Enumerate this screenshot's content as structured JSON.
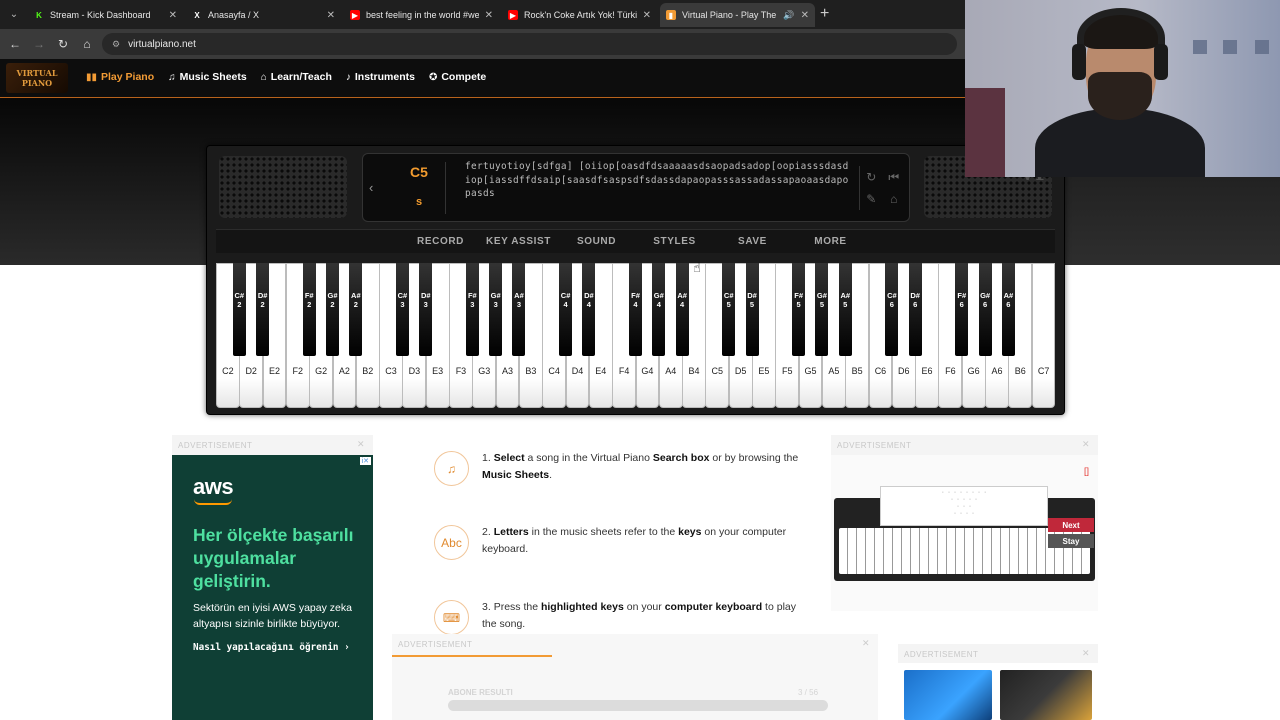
{
  "browser": {
    "tabs": [
      {
        "title": "Stream - Kick Dashboard",
        "fav_color": "#1f1f1f",
        "fav_glyph": "K",
        "fav_text": "#53fc18",
        "active": false
      },
      {
        "title": "Anasayfa / X",
        "fav_color": "#1f1f1f",
        "fav_glyph": "X",
        "fav_text": "#ffffff",
        "active": false
      },
      {
        "title": "best feeling in the world #wee",
        "fav_color": "#ff0000",
        "fav_glyph": "▶",
        "fav_text": "#ffffff",
        "active": false
      },
      {
        "title": "Rock'n Coke Artık Yok! Türkiye'",
        "fav_color": "#ff0000",
        "fav_glyph": "▶",
        "fav_text": "#ffffff",
        "active": false
      },
      {
        "title": "Virtual Piano - Play The Be",
        "fav_color": "#f29b35",
        "fav_glyph": "▮",
        "fav_text": "#ffffff",
        "active": true
      }
    ],
    "url": "virtualpiano.net"
  },
  "site": {
    "logo_line1": "VIRTUAL",
    "logo_line2": "PIANO",
    "nav": [
      {
        "label": "Play Piano",
        "icon": "piano-keys-icon",
        "glyph": "▮▮",
        "active": true
      },
      {
        "label": "Music Sheets",
        "icon": "music-notes-icon",
        "glyph": "♫",
        "active": false
      },
      {
        "label": "Learn/Teach",
        "icon": "graduation-cap-icon",
        "glyph": "⌂",
        "active": false
      },
      {
        "label": "Instruments",
        "icon": "guitar-icon",
        "glyph": "♪",
        "active": false
      },
      {
        "label": "Compete",
        "icon": "trophy-icon",
        "glyph": "✪",
        "active": false
      }
    ]
  },
  "piano": {
    "current_note": "C5",
    "current_key": "s",
    "sheet_text": "fertuyotioy[sdfga] [oiiop[oasdfdsaaaaasdsaopadsadop[oopiasssdasdiop[iassdffdsaip[saasdfsaspsdfsdassdapaopasssassadassapaoaasdapopasds",
    "menu": [
      "RECORD",
      "KEY ASSIST",
      "SOUND",
      "STYLES",
      "SAVE",
      "MORE"
    ],
    "white_keys": [
      "C2",
      "D2",
      "E2",
      "F2",
      "G2",
      "A2",
      "B2",
      "C3",
      "D3",
      "E3",
      "F3",
      "G3",
      "A3",
      "B3",
      "C4",
      "D4",
      "E4",
      "F4",
      "G4",
      "A4",
      "B4",
      "C5",
      "D5",
      "E5",
      "F5",
      "G5",
      "A5",
      "B5",
      "C6",
      "D6",
      "E6",
      "F6",
      "G6",
      "A6",
      "B6",
      "C7"
    ],
    "black_keys": [
      {
        "name": "C#",
        "oct": "2"
      },
      {
        "name": "D#",
        "oct": "2"
      },
      {
        "name": "F#",
        "oct": "2"
      },
      {
        "name": "G#",
        "oct": "2"
      },
      {
        "name": "A#",
        "oct": "2"
      },
      {
        "name": "C#",
        "oct": "3"
      },
      {
        "name": "D#",
        "oct": "3"
      },
      {
        "name": "F#",
        "oct": "3"
      },
      {
        "name": "G#",
        "oct": "3"
      },
      {
        "name": "A#",
        "oct": "3"
      },
      {
        "name": "C#",
        "oct": "4"
      },
      {
        "name": "D#",
        "oct": "4"
      },
      {
        "name": "F#",
        "oct": "4"
      },
      {
        "name": "G#",
        "oct": "4"
      },
      {
        "name": "A#",
        "oct": "4"
      },
      {
        "name": "C#",
        "oct": "5"
      },
      {
        "name": "D#",
        "oct": "5"
      },
      {
        "name": "F#",
        "oct": "5"
      },
      {
        "name": "G#",
        "oct": "5"
      },
      {
        "name": "A#",
        "oct": "5"
      },
      {
        "name": "C#",
        "oct": "6"
      },
      {
        "name": "D#",
        "oct": "6"
      },
      {
        "name": "F#",
        "oct": "6"
      },
      {
        "name": "G#",
        "oct": "6"
      },
      {
        "name": "A#",
        "oct": "6"
      }
    ]
  },
  "ads": {
    "label": "ADVERTISEMENT",
    "aws": {
      "brand": "aws",
      "headline": "Her ölçekte başarılı uygulamalar geliştirin.",
      "body": "Sektörün en iyisi AWS yapay zeka altyapısı sizinle birlikte büyüyor.",
      "cta": "Nasıl yapılacağını öğrenin ›"
    },
    "mid": {
      "progress_label": "ABONE RESULTI",
      "progress_count": "3 / 56",
      "progress_fraction": 1.0
    },
    "right": {
      "next_label": "Next",
      "stay_label": "Stay"
    }
  },
  "instructions": [
    {
      "icon": "music-note-icon",
      "glyph": "♫",
      "num": "1.",
      "parts": [
        [
          "b",
          "Select"
        ],
        [
          "t",
          " a song in the Virtual Piano "
        ],
        [
          "b",
          "Search box"
        ],
        [
          "t",
          " or by browsing the "
        ],
        [
          "b",
          "Music Sheets"
        ],
        [
          "t",
          "."
        ]
      ]
    },
    {
      "icon": "abc-letters-icon",
      "glyph": "Abc",
      "num": "2.",
      "parts": [
        [
          "b",
          "Letters"
        ],
        [
          "t",
          " in the music sheets refer to the "
        ],
        [
          "b",
          "keys"
        ],
        [
          "t",
          " on your computer keyboard."
        ]
      ]
    },
    {
      "icon": "keyboard-icon",
      "glyph": "⌨",
      "num": "3.",
      "parts": [
        [
          "t",
          "Press the "
        ],
        [
          "b",
          "highlighted keys"
        ],
        [
          "t",
          " on your "
        ],
        [
          "b",
          "computer keyboard"
        ],
        [
          "t",
          " to play the song."
        ]
      ]
    }
  ],
  "colors": {
    "accent": "#f29b35",
    "aws_bg": "#0f3f35",
    "aws_headline": "#4ee0a0"
  }
}
